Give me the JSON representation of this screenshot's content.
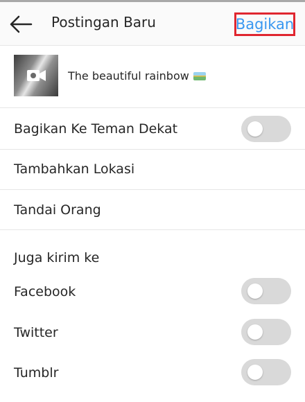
{
  "header": {
    "back_icon": "back-arrow-icon",
    "title": "Postingan Baru",
    "share_label": "Bagikan",
    "share_highlight_color": "#e0262f",
    "share_text_color": "#3897f0"
  },
  "post": {
    "thumbnail_icon": "video-camera-icon",
    "caption": "The beautiful rainbow",
    "caption_emoji": "rainbow-emoji"
  },
  "options": {
    "close_friends": {
      "label": "Bagikan Ke Teman Dekat",
      "enabled": false
    },
    "add_location": {
      "label": "Tambahkan Lokasi"
    },
    "tag_people": {
      "label": "Tandai Orang"
    }
  },
  "also_send": {
    "heading": "Juga kirim ke",
    "targets": [
      {
        "label": "Facebook",
        "enabled": false
      },
      {
        "label": "Twitter",
        "enabled": false
      },
      {
        "label": "Tumblr",
        "enabled": false
      }
    ]
  },
  "colors": {
    "toggle_off": "#d9d9d9",
    "separator": "#e6e6e6"
  }
}
